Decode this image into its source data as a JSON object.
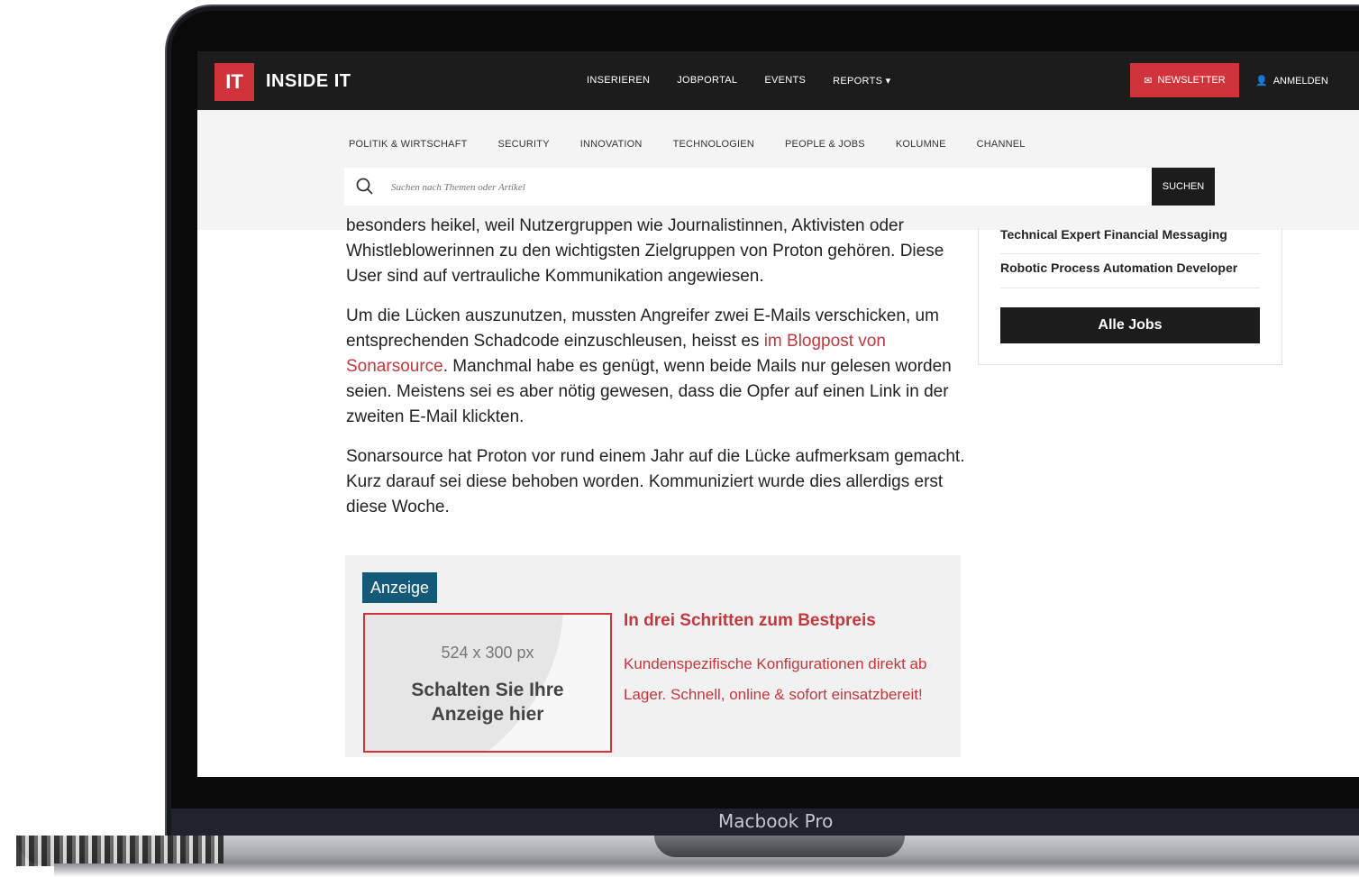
{
  "device": {
    "label": "Macbook Pro"
  },
  "header": {
    "logo_mark": "IT",
    "logo_text": "INSIDE IT",
    "nav": [
      "INSERIEREN",
      "JOBPORTAL",
      "EVENTS",
      "REPORTS"
    ],
    "newsletter_label": "NEWSLETTER",
    "login_label": "ANMELDEN"
  },
  "subnav": {
    "items": [
      "POLITIK & WIRTSCHAFT",
      "SECURITY",
      "INNOVATION",
      "TECHNOLOGIEN",
      "PEOPLE & JOBS",
      "KOLUMNE",
      "CHANNEL"
    ]
  },
  "search": {
    "placeholder": "Suchen nach Themen oder Artikel",
    "button_label": "SUCHEN"
  },
  "article": {
    "p1": "besonders heikel, weil Nutzergruppen wie Journalistinnen, Aktivisten oder Whistleblowerinnen zu den wichtigsten Zielgruppen von Proton gehören. Diese User sind auf vertrauliche Kommunikation angewiesen.",
    "p2_before": "Um die Lücken auszunutzen, mussten Angreifer zwei E-Mails verschicken, um entsprechenden Schadcode einzuschleusen, heisst es ",
    "p2_link": "im Blogpost von Sonarsource",
    "p2_after": ". Manchmal habe es genügt, wenn beide Mails nur gelesen worden seien. Meistens sei es aber nötig gewesen, dass die Opfer auf einen Link in der zweiten E-Mail klickten.",
    "p3": "Sonarsource hat Proton vor rund einem Jahr auf die Lücke aufmerksam gemacht. Kurz darauf sei diese behoben worden. Kommuniziert wurde dies allerdigs erst diese Woche."
  },
  "sidebar": {
    "jobs": [
      "Technical Expert Financial Messaging",
      "Robotic Process Automation Developer"
    ],
    "all_jobs_label": "Alle Jobs"
  },
  "ad": {
    "tag": "Anzeige",
    "size_label": "524 x 300 px",
    "cta": "Schalten Sie Ihre Anzeige hier",
    "title": "In drei Schritten zum Bestpreis",
    "text": "Kundenspezifische Konfigurationen direkt ab Lager. Schnell, online & sofort einsatzbereit!"
  },
  "colors": {
    "brand_red": "#d0343a",
    "dark": "#1c1c1c",
    "ad_tag": "#135a78",
    "link": "#c4373d"
  }
}
